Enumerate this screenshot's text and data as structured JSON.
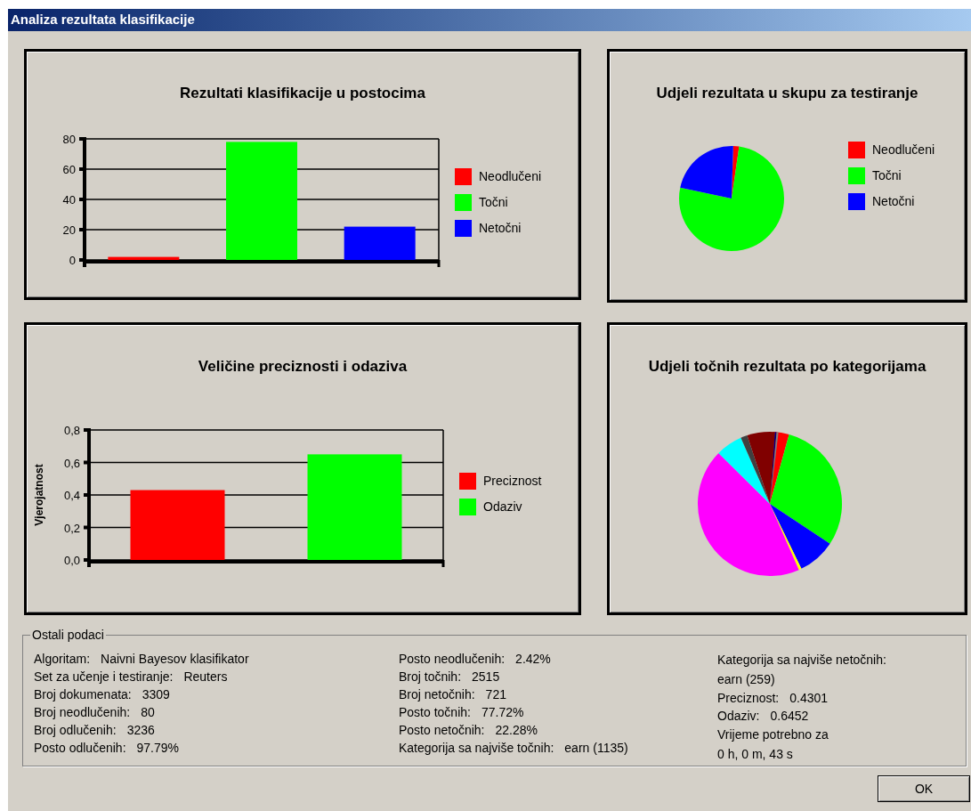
{
  "window": {
    "title": "Analiza rezultata klasifikacije"
  },
  "panels": [
    {
      "kind": "bar",
      "chart_data": {
        "type": "bar",
        "title": "Rezultati klasifikacije u postocima",
        "grid": true,
        "legend": "right",
        "ylim": [
          0,
          80
        ],
        "yticks": [
          0,
          20,
          40,
          60,
          80
        ],
        "series": [
          {
            "name": "Neodlučeni",
            "color": "#ff0000",
            "values": [
              2
            ]
          },
          {
            "name": "Točni",
            "color": "#00ff00",
            "values": [
              78
            ]
          },
          {
            "name": "Netočni",
            "color": "#0000ff",
            "values": [
              22
            ]
          }
        ]
      }
    },
    {
      "kind": "pie",
      "title": "Udjeli rezultata u skupu za testiranje",
      "legend": [
        {
          "label": "Neodlučeni",
          "color": "#ff0000"
        },
        {
          "label": "Točni",
          "color": "#00ff00"
        },
        {
          "label": "Netočni",
          "color": "#0000ff"
        }
      ]
    },
    {
      "kind": "bar",
      "chart_data": {
        "type": "bar",
        "title": "Veličine preciznosti i odaziva",
        "grid": true,
        "legend": "right",
        "ylabel": "Vjerojatnost",
        "ylim": [
          0,
          0.8
        ],
        "yticks": [
          {
            "value": 0,
            "label": "0,0"
          },
          {
            "value": 0.2,
            "label": "0,2"
          },
          {
            "value": 0.4,
            "label": "0,4"
          },
          {
            "value": 0.6,
            "label": "0,6"
          },
          {
            "value": 0.8,
            "label": "0,8"
          }
        ],
        "series": [
          {
            "name": "Preciznost",
            "color": "#ff0000",
            "values": [
              0.43
            ]
          },
          {
            "name": "Odaziv",
            "color": "#00ff00",
            "values": [
              0.65
            ]
          }
        ]
      }
    },
    {
      "kind": "pie",
      "title": "Udjeli točnih rezultata po kategorijama"
    }
  ],
  "details": {
    "title": "Ostali podaci",
    "columns": [
      [
        {
          "kind": "inline",
          "label": "Algoritam:",
          "value": "Naivni Bayesov klasifikator"
        },
        {
          "kind": "inline",
          "label": "Set za učenje i testiranje:",
          "value": "Reuters"
        },
        {
          "kind": "inline",
          "label": "Broj dokumenata:",
          "value": "3309"
        },
        {
          "kind": "inline",
          "label": "Broj neodlučenih:",
          "value": "80"
        },
        {
          "kind": "inline",
          "label": "Broj odlučenih:",
          "value": "3236"
        },
        {
          "kind": "inline",
          "label": "Posto odlučenih:",
          "value": "97.79%"
        }
      ],
      [
        {
          "kind": "inline",
          "label": "Posto neodlučenih:",
          "value": "2.42%"
        },
        {
          "kind": "inline",
          "label": "Broj točnih:",
          "value": "2515"
        },
        {
          "kind": "inline",
          "label": "Broj netočnih:",
          "value": "721"
        },
        {
          "kind": "inline",
          "label": "Posto točnih:",
          "value": "77.72%"
        },
        {
          "kind": "inline",
          "label": "Posto netočnih:",
          "value": "22.28%"
        },
        {
          "kind": "inline",
          "label": "Kategorija sa najviše točnih:",
          "value": "earn (1135)"
        }
      ],
      [
        {
          "kind": "stacked",
          "label": "Kategorija sa najviše netočnih:",
          "value": "earn (259)"
        },
        {
          "kind": "inline",
          "label": "Preciznost:",
          "value": "0.4301"
        },
        {
          "kind": "inline",
          "label": "Odaziv:",
          "value": "0.6452"
        },
        {
          "kind": "stacked",
          "label": "Vrijeme potrebno za",
          "value": "0 h, 0 m, 43 s"
        }
      ]
    ]
  },
  "ok_button": "OK"
}
